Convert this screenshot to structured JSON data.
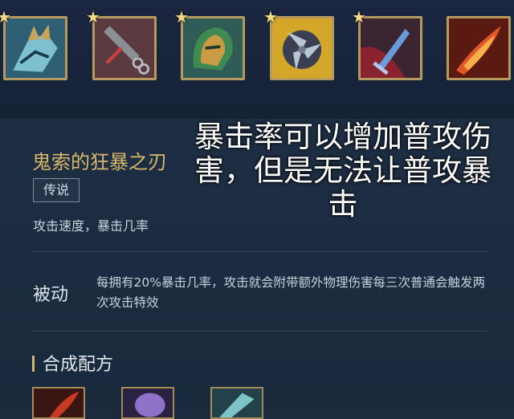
{
  "top_items": [
    {
      "icon": "claw-gauntlet-icon",
      "starred": true
    },
    {
      "icon": "chain-flail-icon",
      "starred": true
    },
    {
      "icon": "green-helmet-icon",
      "starred": true
    },
    {
      "icon": "triskelion-blades-icon",
      "starred": true
    },
    {
      "icon": "frost-dagger-icon",
      "starred": true
    },
    {
      "icon": "flame-sword-icon",
      "starred": false
    }
  ],
  "item": {
    "name": "鬼索的狂暴之刃",
    "rarity": "传说",
    "stats": "攻击速度，暴击几率"
  },
  "passive": {
    "label": "被动",
    "description": "每拥有20%暴击几率，攻击就会附带额外物理伤害每三次普通会触发两次攻击特效"
  },
  "recipe": {
    "title": "合成配方",
    "items": [
      "red-blade-icon",
      "purple-orb-icon",
      "teal-glaive-icon"
    ]
  },
  "overlay_caption": {
    "lines": [
      "暴击率可以增加普攻伤",
      "害，但是无法让普攻暴",
      "击"
    ]
  },
  "colors": {
    "background": "#1b2a3c",
    "gold_accent": "#d8b86b",
    "frame_gold": "#b49a5e"
  }
}
